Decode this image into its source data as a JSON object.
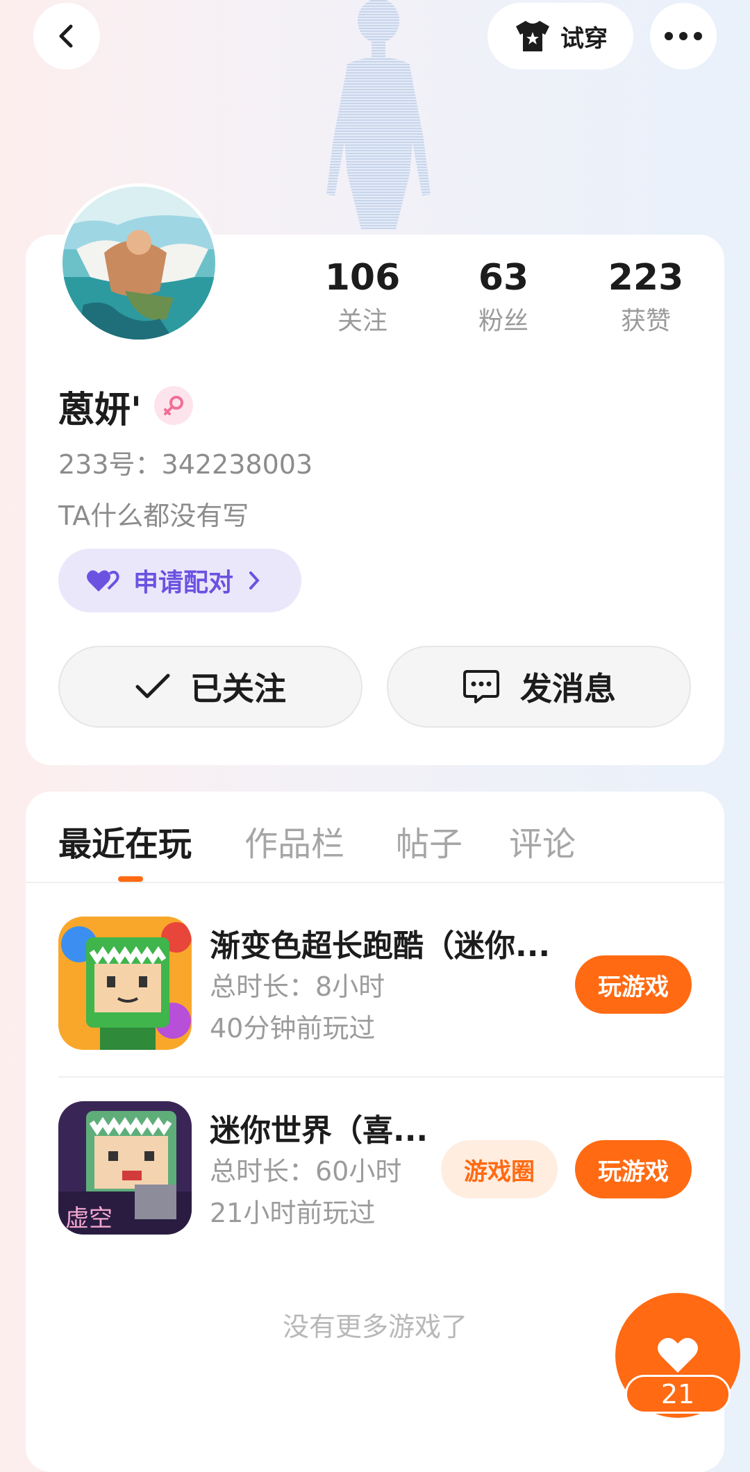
{
  "topbar": {
    "try_on_label": "试穿",
    "icons": {
      "back": "back-arrow-icon",
      "try_on": "tshirt-icon",
      "more": "more-dots-icon"
    }
  },
  "profile": {
    "stats": [
      {
        "value": "106",
        "label": "关注"
      },
      {
        "value": "63",
        "label": "粉丝"
      },
      {
        "value": "223",
        "label": "获赞"
      }
    ],
    "name": "蒽妍'",
    "gender": "female",
    "uid": "233号：342238003",
    "bio": "TA什么都没有写",
    "pair_button": "申请配对",
    "follow_button": "已关注",
    "message_button": "发消息"
  },
  "tabs": [
    {
      "label": "最近在玩",
      "active": true
    },
    {
      "label": "作品栏",
      "active": false
    },
    {
      "label": "帖子",
      "active": false
    },
    {
      "label": "评论",
      "active": false
    }
  ],
  "games": [
    {
      "title": "渐变色超长跑酷（迷你...",
      "duration": "总时长：8小时",
      "last_played": "40分钟前玩过",
      "play_label": "玩游戏"
    },
    {
      "title": "迷你世界（喜...",
      "duration": "总时长：60小时",
      "last_played": "21小时前玩过",
      "circle_label": "游戏圈",
      "play_label": "玩游戏"
    }
  ],
  "no_more_text": "没有更多游戏了",
  "like": {
    "count": "21"
  },
  "colors": {
    "accent": "#ff6a13",
    "pair_text": "#6b52e0",
    "pair_bg": "#ebe7fb"
  }
}
